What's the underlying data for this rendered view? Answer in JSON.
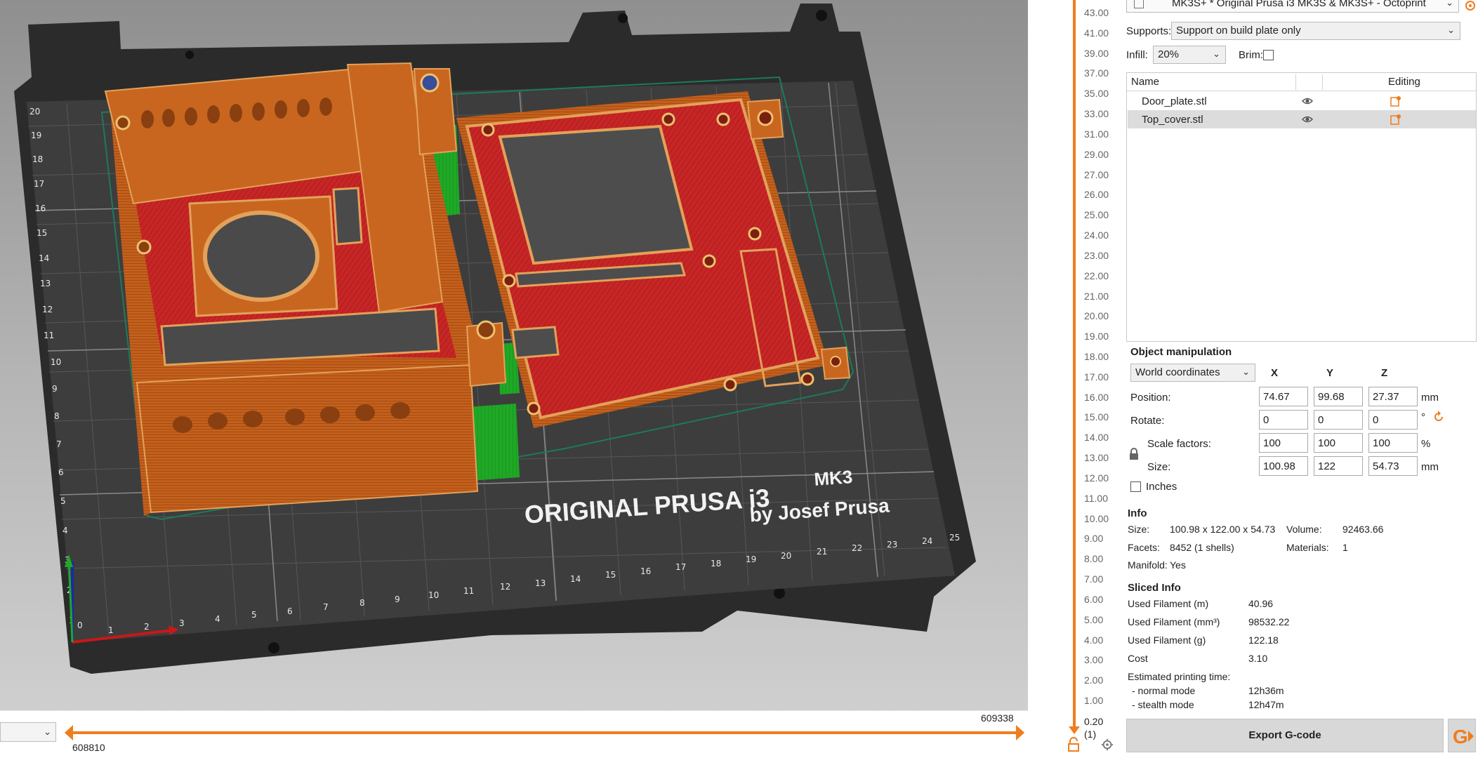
{
  "app": {
    "accent": "#ef7d1e"
  },
  "viewport": {
    "bed_brand_line1": "ORIGINAL PRUSA i3",
    "bed_brand_model": "MK3",
    "bed_brand_line2": "by Josef Prusa",
    "bed_x_ticks": [
      "0",
      "1",
      "2",
      "3",
      "4",
      "5",
      "6",
      "7",
      "8",
      "9",
      "10",
      "11",
      "12",
      "13",
      "14",
      "15",
      "16",
      "17",
      "18",
      "19",
      "20",
      "21",
      "22",
      "23",
      "24",
      "25"
    ],
    "bed_y_ticks": [
      "1",
      "2",
      "3",
      "4",
      "5",
      "6",
      "7",
      "8",
      "9",
      "10",
      "11",
      "12",
      "13",
      "14",
      "15",
      "16",
      "17",
      "18",
      "19",
      "20"
    ],
    "colors": {
      "perimeter": "#c8641e",
      "infill": "#c92424",
      "support": "#22b02a",
      "bed": "#2f2f2f",
      "frame": "#2a2a2a"
    }
  },
  "hslider": {
    "left_value": "608810",
    "right_value": "609338"
  },
  "vslider": {
    "labels": [
      "43.00",
      "41.00",
      "39.00",
      "37.00",
      "35.00",
      "33.00",
      "31.00",
      "29.00",
      "27.00",
      "26.00",
      "25.00",
      "24.00",
      "23.00",
      "22.00",
      "21.00",
      "20.00",
      "19.00",
      "18.00",
      "17.00",
      "16.00",
      "15.00",
      "14.00",
      "13.00",
      "12.00",
      "11.00",
      "10.00",
      "9.00",
      "8.00",
      "7.00",
      "6.00",
      "5.00",
      "4.00",
      "3.00",
      "2.00",
      "1.00"
    ],
    "bottom_value": "0.20",
    "bottom_sub": "(1)"
  },
  "sidebar": {
    "printer": "MK3S+ * Original Prusa i3 MK3S & MK3S+ - Octoprint",
    "supports_label": "Supports:",
    "supports_value": "Support on build plate only",
    "infill_label": "Infill:",
    "infill_value": "20%",
    "brim_label": "Brim:",
    "brim_checked": false,
    "objects": {
      "col_name": "Name",
      "col_editing": "Editing",
      "rows": [
        {
          "name": "Door_plate.stl",
          "selected": false
        },
        {
          "name": "Top_cover.stl",
          "selected": true
        }
      ]
    },
    "manipulation": {
      "title": "Object manipulation",
      "coord_system": "World coordinates",
      "axes": [
        "X",
        "Y",
        "Z"
      ],
      "position_label": "Position:",
      "position": [
        "74.67",
        "99.68",
        "27.37"
      ],
      "position_unit": "mm",
      "rotate_label": "Rotate:",
      "rotate": [
        "0",
        "0",
        "0"
      ],
      "rotate_unit": "°",
      "scale_label": "Scale factors:",
      "scale": [
        "100",
        "100",
        "100"
      ],
      "scale_unit": "%",
      "size_label": "Size:",
      "size": [
        "100.98",
        "122",
        "54.73"
      ],
      "size_unit": "mm",
      "inches_label": "Inches"
    },
    "info": {
      "title": "Info",
      "size_label": "Size:",
      "size_value": "100.98 x 122.00 x 54.73",
      "volume_label": "Volume:",
      "volume_value": "92463.66",
      "facets_label": "Facets:",
      "facets_value": "8452 (1 shells)",
      "materials_label": "Materials:",
      "materials_value": "1",
      "manifold_label": "Manifold:",
      "manifold_value": "Yes"
    },
    "sliced": {
      "title": "Sliced Info",
      "rows": [
        {
          "label": "Used Filament (m)",
          "value": "40.96"
        },
        {
          "label": "Used Filament (mm³)",
          "value": "98532.22"
        },
        {
          "label": "Used Filament (g)",
          "value": "122.18"
        },
        {
          "label": "Cost",
          "value": "3.10"
        }
      ],
      "time_label": "Estimated printing time:",
      "normal_label": "- normal mode",
      "normal_value": "12h36m",
      "stealth_label": "- stealth mode",
      "stealth_value": "12h47m"
    },
    "export_label": "Export G-code"
  }
}
